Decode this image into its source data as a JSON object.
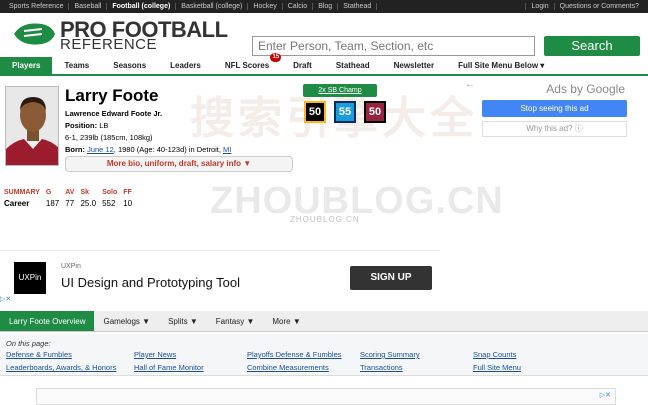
{
  "topbar": {
    "items": [
      "Sports Reference",
      "Baseball",
      "Football (college)",
      "Basketball (college)",
      "Hockey",
      "Calcio",
      "Blog",
      "Stathead"
    ],
    "right": [
      "Login",
      "Questions or Comments?"
    ]
  },
  "logo": {
    "line1": "PRO FOOTBALL",
    "line2": "REFERENCE"
  },
  "search": {
    "placeholder": "Enter Person, Team, Section, etc",
    "button": "Search"
  },
  "nav": {
    "items": [
      "Players",
      "Teams",
      "Seasons",
      "Leaders",
      "NFL Scores",
      "Draft",
      "Stathead",
      "Newsletter",
      "Full Site Menu Below ▾"
    ],
    "badge": "15"
  },
  "player": {
    "name": "Larry Foote",
    "fullname": "Lawrence Edward Foote Jr.",
    "position_label": "Position:",
    "position": "LB",
    "measures": "6-1, 239lb (185cm, 108kg)",
    "born_label": "Born:",
    "born_date": "June 12",
    "born_rest": ", 1980 (Age: 40-123d) in Detroit,",
    "born_state": "MI",
    "more_bio": "More bio, uniform, draft, salary info ▼",
    "sb_champ": "2x SB Champ",
    "jerseys": [
      "50",
      "55",
      "50"
    ],
    "jersey_colors": [
      "#FFB612",
      "#1c9cd8",
      "#97233F"
    ]
  },
  "ads_panel": {
    "back": "←",
    "title": "Ads by Google",
    "stop": "Stop seeing this ad",
    "why": "Why this ad? ⓘ"
  },
  "summary": {
    "headers": [
      "SUMMARY",
      "G",
      "AV",
      "Sk",
      "Solo",
      "FF"
    ],
    "row": [
      "Career",
      "187",
      "77",
      "25.0",
      "552",
      "10"
    ]
  },
  "watermark": {
    "cn": "搜索引擎大全",
    "en": "ZHOUBLOG.CN",
    "small": "ZHOUBLOG.CN"
  },
  "ad_banner": {
    "logo": "UXPin",
    "source": "UXPin",
    "title": "UI Design and Prototyping Tool",
    "cta": "SIGN UP",
    "choice": "▷✕"
  },
  "subnav": {
    "items": [
      "Larry Foote Overview",
      "Gamelogs ▼",
      "Splits ▼",
      "Fantasy ▼",
      "More ▼"
    ]
  },
  "onpage": {
    "title": "On this page:",
    "links": [
      "Defense & Fumbles",
      "Leaderboards, Awards, & Honors",
      "Player News",
      "Hall of Fame Monitor",
      "Playoffs Defense & Fumbles",
      "Combine Measurements",
      "Scoring Summary",
      "Transactions",
      "Snap Counts",
      "Full Site Menu"
    ]
  },
  "bottom_ad": {
    "choice": "▷✕"
  }
}
